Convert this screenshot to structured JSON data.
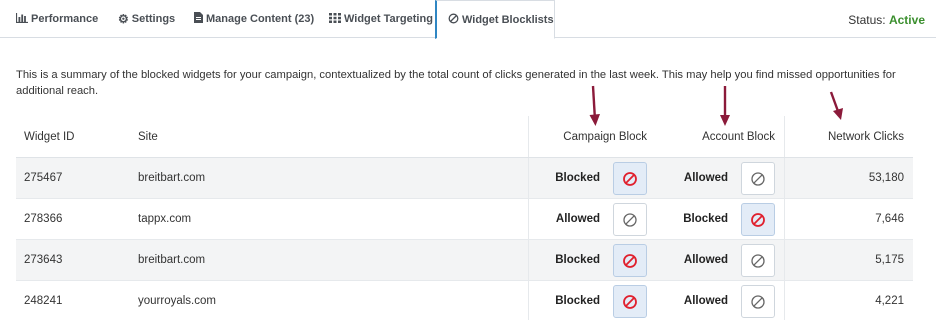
{
  "tabs": [
    {
      "label": "Performance",
      "icon": "bar-chart-icon"
    },
    {
      "label": "Settings",
      "icon": "gear-icon"
    },
    {
      "label": "Manage Content (23)",
      "icon": "document-icon"
    },
    {
      "label": "Widget Targeting",
      "icon": "grid-icon"
    },
    {
      "label": "Widget Blocklists",
      "icon": "block-icon"
    }
  ],
  "status": {
    "label": "Status:",
    "value": "Active",
    "value_color": "#3b8f2e"
  },
  "description": "This is a summary of the blocked widgets for your campaign, contextualized by the total count of clicks generated in the last week. This may help you find missed opportunities for additional reach.",
  "table": {
    "headers": {
      "widget_id": "Widget ID",
      "site": "Site",
      "campaign_block": "Campaign Block",
      "account_block": "Account Block",
      "network_clicks": "Network Clicks"
    },
    "rows": [
      {
        "widget_id": "275467",
        "site": "breitbart.com",
        "campaign_state": "Blocked",
        "account_state": "Allowed",
        "clicks": "53,180"
      },
      {
        "widget_id": "278366",
        "site": "tappx.com",
        "campaign_state": "Allowed",
        "account_state": "Blocked",
        "clicks": "7,646"
      },
      {
        "widget_id": "273643",
        "site": "breitbart.com",
        "campaign_state": "Blocked",
        "account_state": "Allowed",
        "clicks": "5,175"
      },
      {
        "widget_id": "248241",
        "site": "yourroyals.com",
        "campaign_state": "Blocked",
        "account_state": "Allowed",
        "clicks": "4,221"
      }
    ]
  },
  "colors": {
    "accent": "#2f86c3",
    "blocked_icon": "#e0202e",
    "allowed_icon": "#666666",
    "annotation_arrow": "#8b1a3a"
  }
}
